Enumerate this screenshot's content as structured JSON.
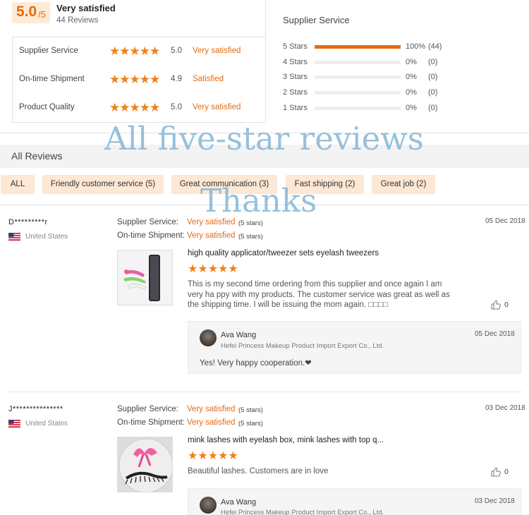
{
  "summary": {
    "score": "5.0",
    "score_out_of": "/5",
    "title": "Very satisfied",
    "reviews_count": "44 Reviews"
  },
  "ratings": [
    {
      "label": "Supplier Service",
      "stars": "★★★★★",
      "score": "5.0",
      "text": "Very satisfied"
    },
    {
      "label": "On-time Shipment",
      "stars": "★★★★★",
      "score": "4.9",
      "text": "Satisfied"
    },
    {
      "label": "Product Quality",
      "stars": "★★★★★",
      "score": "5.0",
      "text": "Very satisfied"
    }
  ],
  "distribution": {
    "title": "Supplier Service",
    "rows": [
      {
        "label": "5 Stars",
        "percent": "100%",
        "count": "(44)",
        "fraction": 1.0
      },
      {
        "label": "4 Stars",
        "percent": "0%",
        "count": "(0)",
        "fraction": 0
      },
      {
        "label": "3 Stars",
        "percent": "0%",
        "count": "(0)",
        "fraction": 0
      },
      {
        "label": "2 Stars",
        "percent": "0%",
        "count": "(0)",
        "fraction": 0
      },
      {
        "label": "1 Stars",
        "percent": "0%",
        "count": "(0)",
        "fraction": 0
      }
    ]
  },
  "all_reviews": {
    "header": "All Reviews",
    "filters": [
      "ALL",
      "Friendly customer service (5)",
      "Great communication (3)",
      "Fast shipping (2)",
      "Great job (2)"
    ]
  },
  "watermark": {
    "line1": "All five-star reviews",
    "line2": "Thanks"
  },
  "reviews": [
    {
      "reviewer": "D*********r",
      "country": "United States",
      "supplier_service_label": "Supplier Service:",
      "supplier_service_value": "Very satisfied",
      "supplier_service_stars": "(5 stars)",
      "shipment_label": "On-time Shipment:",
      "shipment_value": "Very satisfied",
      "shipment_stars": "(5 stars)",
      "date": "05 Dec 2018",
      "product_title": "high quality applicator/tweezer sets eyelash tweezers",
      "stars": "★★★★★",
      "text": "This is my second time ordering from this supplier and once again I am very ha ppy with my products. The customer service was great as well as the shipping time. I will be issuing the mom again. □□□□",
      "likes": "0",
      "reply": {
        "name": "Ava Wang",
        "company": "Hefei Princess Makeup Product Import Export Co., Ltd.",
        "date": "05 Dec 2018",
        "text": "Yes! Very happy cooperation.❤"
      }
    },
    {
      "reviewer": "J***************",
      "country": "United States",
      "supplier_service_label": "Supplier Service:",
      "supplier_service_value": "Very satisfied",
      "supplier_service_stars": "(5 stars)",
      "shipment_label": "On-time Shipment:",
      "shipment_value": "Very satisfied",
      "shipment_stars": "(5 stars)",
      "date": "03 Dec 2018",
      "product_title": "mink lashes with eyelash box, mink lashes with top q...",
      "stars": "★★★★★",
      "text": "Beautiful lashes. Customers are in love",
      "likes": "0",
      "reply": {
        "name": "Ava Wang",
        "company": "Hefei Princess Makeup Product Import Export Co., Ltd.",
        "date": "03 Dec 2018"
      }
    }
  ],
  "colors": {
    "accent": "#e66a12",
    "chip_bg": "#fde7d5",
    "star": "#f08018"
  }
}
